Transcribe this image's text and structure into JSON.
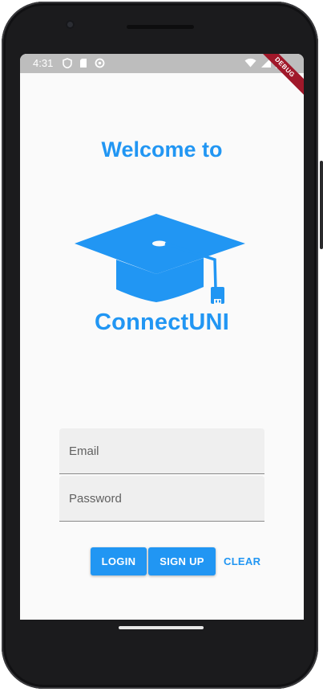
{
  "status_bar": {
    "time": "4:31",
    "icons_left": [
      "shield-icon",
      "sd-card-icon",
      "sync-icon"
    ],
    "icons_right": [
      "wifi-icon",
      "signal-icon",
      "battery-icon"
    ]
  },
  "debug_banner": {
    "label": "DEBUG"
  },
  "welcome": {
    "title": "Welcome to",
    "logo_text": "ConnectUNI",
    "logo_icon": "graduation-cap-usb-icon"
  },
  "form": {
    "email_placeholder": "Email",
    "email_value": "",
    "password_placeholder": "Password",
    "password_value": ""
  },
  "actions": {
    "login_label": "LOGIN",
    "signup_label": "SIGN UP",
    "clear_label": "CLEAR"
  },
  "colors": {
    "accent": "#2196f3",
    "background": "#fafafa",
    "status_bar": "#bdbdbd",
    "field_fill": "#efefef",
    "debug_banner": "#a0182a"
  }
}
